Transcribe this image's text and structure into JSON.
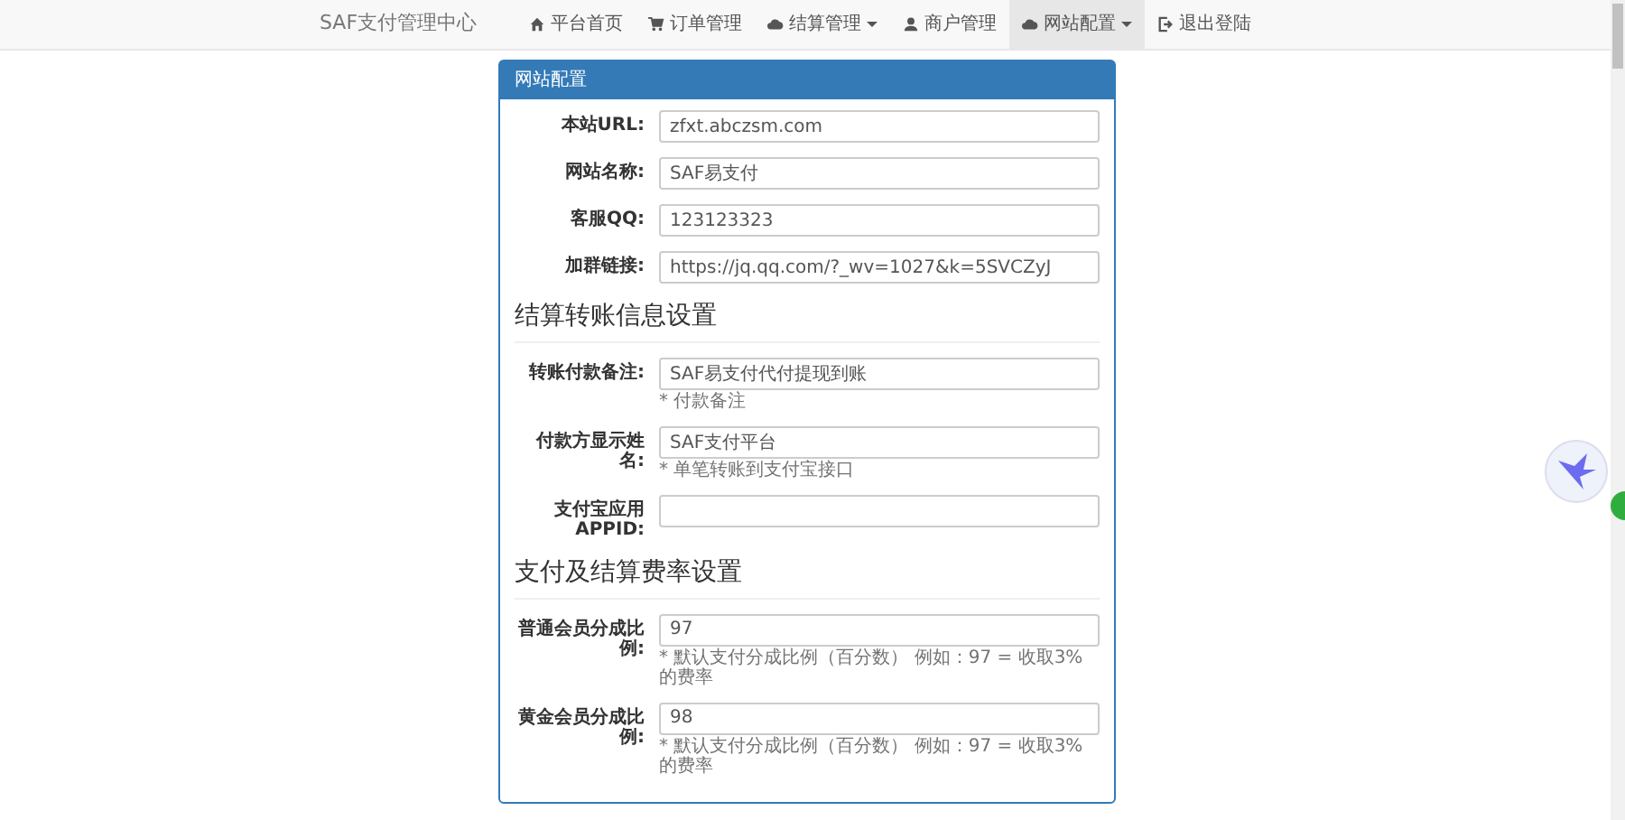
{
  "navbar": {
    "brand": "SAF支付管理中心",
    "items": [
      {
        "label": "平台首页",
        "kind": "home",
        "dropdown": false,
        "selected": false
      },
      {
        "label": "订单管理",
        "kind": "cart",
        "dropdown": false,
        "selected": false
      },
      {
        "label": "结算管理",
        "kind": "cloud",
        "dropdown": true,
        "selected": false
      },
      {
        "label": "商户管理",
        "kind": "user",
        "dropdown": false,
        "selected": false
      },
      {
        "label": "网站配置",
        "kind": "cloud",
        "dropdown": true,
        "selected": true
      },
      {
        "label": "退出登陆",
        "kind": "logout",
        "dropdown": false,
        "selected": false
      }
    ]
  },
  "panel": {
    "title": "网站配置",
    "sections": [
      {
        "fields": [
          {
            "label": "本站URL:",
            "value": "zfxt.abczsm.com"
          },
          {
            "label": "网站名称:",
            "value": "SAF易支付"
          },
          {
            "label": "客服QQ:",
            "value": "123123323"
          },
          {
            "label": "加群链接:",
            "value": "https://jq.qq.com/?_wv=1027&k=5SVCZyJ"
          }
        ]
      },
      {
        "heading": "结算转账信息设置",
        "fields": [
          {
            "label": "转账付款备注:",
            "value": "SAF易支付代付提现到账",
            "hint": "* 付款备注"
          },
          {
            "label": "付款方显示姓名:",
            "value": "SAF支付平台",
            "hint": "* 单笔转账到支付宝接口"
          },
          {
            "label": "支付宝应用APPID:"
          }
        ]
      },
      {
        "heading": "支付及结算费率设置",
        "fields": [
          {
            "label": "普通会员分成比例:",
            "value": "97",
            "hint": "* 默认支付分成比例（百分数） 例如：97 = 收取3%的费率"
          },
          {
            "label": "黄金会员分成比例:",
            "value": "98",
            "hint": "* 默认支付分成比例（百分数） 例如：97 = 收取3%的费率"
          }
        ]
      }
    ]
  }
}
